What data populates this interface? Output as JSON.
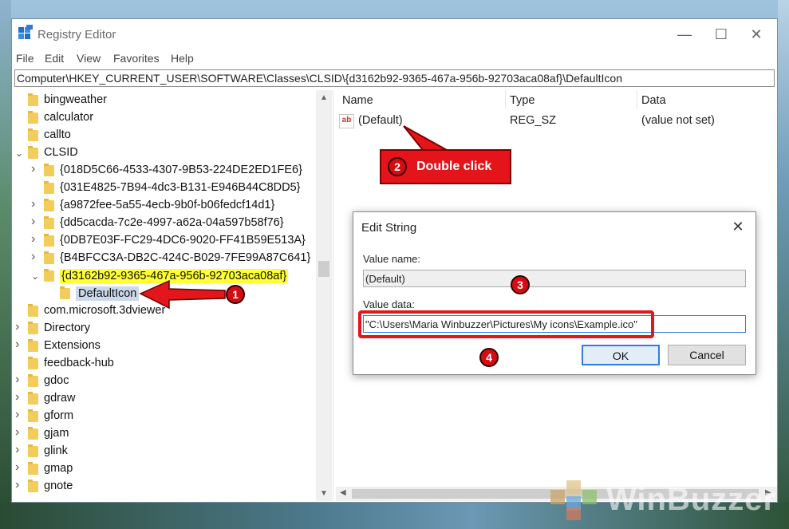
{
  "window": {
    "title": "Registry Editor",
    "controls": {
      "minimize": "—",
      "maximize": "☐",
      "close": "✕"
    }
  },
  "menu": [
    "File",
    "Edit",
    "View",
    "Favorites",
    "Help"
  ],
  "address": "Computer\\HKEY_CURRENT_USER\\SOFTWARE\\Classes\\CLSID\\{d3162b92-9365-467a-956b-92703aca08af}\\DefaultIcon",
  "tree": [
    {
      "label": "bingweather",
      "expand": "none"
    },
    {
      "label": "calculator",
      "expand": "none"
    },
    {
      "label": "callto",
      "expand": "none"
    },
    {
      "label": "CLSID",
      "expand": "open"
    },
    {
      "label": "{018D5C66-4533-4307-9B53-224DE2ED1FE6}",
      "expand": "closed"
    },
    {
      "label": "{031E4825-7B94-4dc3-B131-E946B44C8DD5}",
      "expand": "none"
    },
    {
      "label": "{a9872fee-5a55-4ecb-9b0f-b06fedcf14d1}",
      "expand": "closed"
    },
    {
      "label": "{dd5cacda-7c2e-4997-a62a-04a597b58f76}",
      "expand": "closed"
    },
    {
      "label": "{0DB7E03F-FC29-4DC6-9020-FF41B59E513A}",
      "expand": "closed"
    },
    {
      "label": "{B4BFCC3A-DB2C-424C-B029-7FE99A87C641}",
      "expand": "closed"
    },
    {
      "label": "{d3162b92-9365-467a-956b-92703aca08af}",
      "expand": "open"
    },
    {
      "label": "DefaultIcon",
      "expand": "none"
    },
    {
      "label": "com.microsoft.3dviewer",
      "expand": "none"
    },
    {
      "label": "Directory",
      "expand": "closed"
    },
    {
      "label": "Extensions",
      "expand": "closed"
    },
    {
      "label": "feedback-hub",
      "expand": "none"
    },
    {
      "label": "gdoc",
      "expand": "closed"
    },
    {
      "label": "gdraw",
      "expand": "closed"
    },
    {
      "label": "gform",
      "expand": "closed"
    },
    {
      "label": "gjam",
      "expand": "closed"
    },
    {
      "label": "glink",
      "expand": "closed"
    },
    {
      "label": "gmap",
      "expand": "closed"
    },
    {
      "label": "gnote",
      "expand": "closed"
    }
  ],
  "list": {
    "columns": [
      "Name",
      "Type",
      "Data"
    ],
    "rows": [
      {
        "name": "(Default)",
        "type": "REG_SZ",
        "data": "(value not set)",
        "icon": "ab"
      }
    ]
  },
  "dialog": {
    "title": "Edit String",
    "close": "✕",
    "value_name_label": "Value name:",
    "value_name": "(Default)",
    "value_data_label": "Value data:",
    "value_data": "\"C:\\Users\\Maria Winbuzzer\\Pictures\\My icons\\Example.ico\"",
    "ok": "OK",
    "cancel": "Cancel"
  },
  "annotations": {
    "callout_number": "2",
    "callout_text": "Double click",
    "step1": "1",
    "step3": "3",
    "step4": "4",
    "accent": "#e3161b"
  },
  "watermark": "WinBuzzer"
}
